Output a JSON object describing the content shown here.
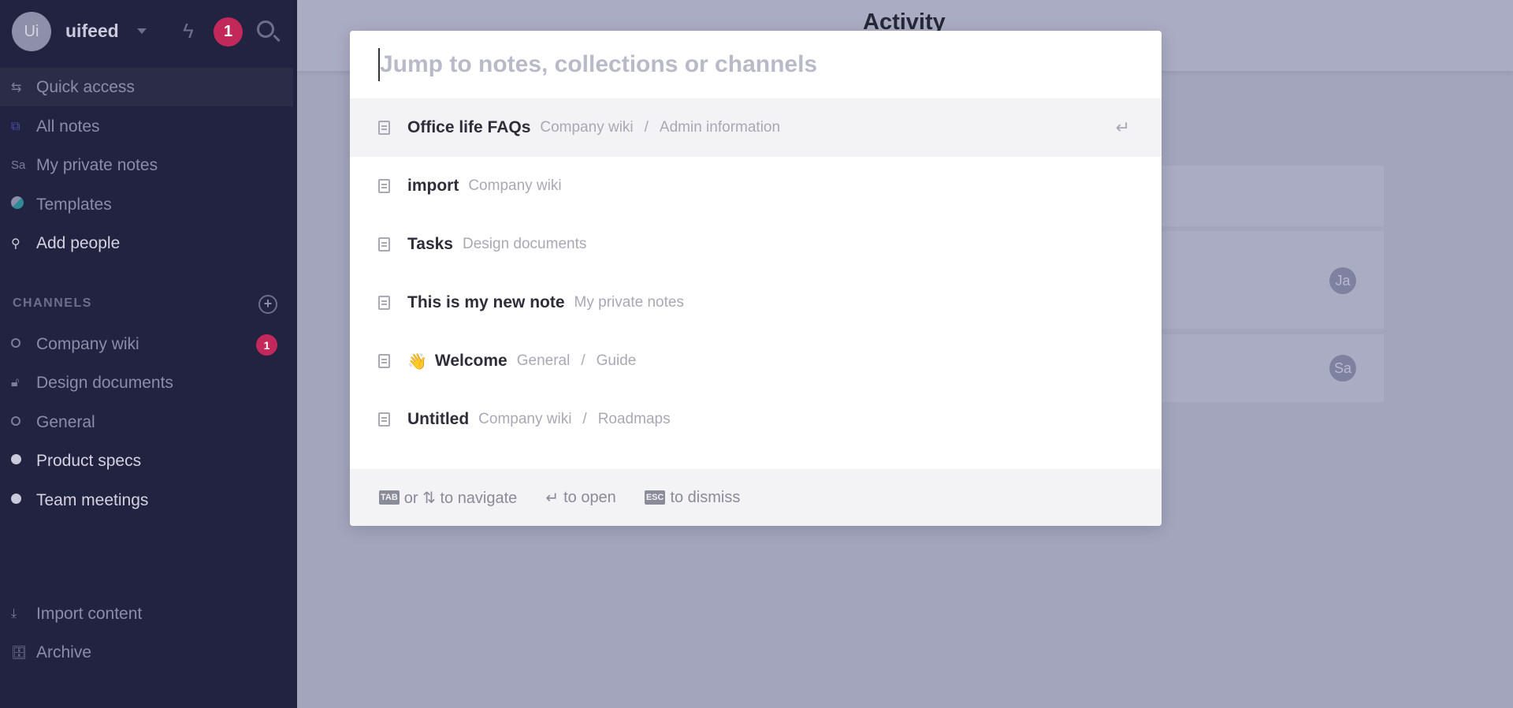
{
  "sidebar": {
    "workspace": {
      "avatar": "Ui",
      "name": "uifeed",
      "notifications": "1"
    },
    "nav": [
      {
        "label": "Quick access",
        "icon": "swap-arrows-icon"
      },
      {
        "label": "All notes",
        "icon": "notes-stack-icon"
      },
      {
        "label": "My private notes",
        "icon_text": "Sa"
      },
      {
        "label": "Templates",
        "icon": "template-circle-icon"
      },
      {
        "label": "Add people",
        "icon": "add-person-icon"
      }
    ],
    "channels_heading": "CHANNELS",
    "channels": [
      {
        "label": "Company wiki",
        "badge": "1"
      },
      {
        "label": "Design documents"
      },
      {
        "label": "General"
      },
      {
        "label": "Product specs"
      },
      {
        "label": "Team meetings"
      }
    ],
    "bottom": [
      {
        "label": "Import content"
      },
      {
        "label": "Archive"
      }
    ]
  },
  "main": {
    "title": "Activity",
    "avatars": [
      "Ja",
      "Sa"
    ]
  },
  "modal": {
    "placeholder": "Jump to notes, collections or channels",
    "results": [
      {
        "title": "Office life FAQs",
        "path": [
          "Company wiki",
          "Admin information"
        ]
      },
      {
        "title": "import",
        "path": [
          "Company wiki"
        ]
      },
      {
        "title": "Tasks",
        "path": [
          "Design documents"
        ]
      },
      {
        "title": "This is my new note",
        "path": [
          "My private notes"
        ]
      },
      {
        "emoji": "👋",
        "title": "Welcome",
        "path": [
          "General",
          "Guide"
        ]
      },
      {
        "title": "Untitled",
        "path": [
          "Company wiki",
          "Roadmaps"
        ]
      }
    ],
    "path_separator": "/",
    "footer": {
      "tab_key": "TAB",
      "navigate": "or ⇅ to navigate",
      "enter_glyph": "↵",
      "open": "to open",
      "esc_key": "ESC",
      "dismiss": "to dismiss"
    }
  },
  "colors": {
    "sidebar": "#212340",
    "badge": "#c3285a",
    "overlay": "#a3a5bd"
  }
}
